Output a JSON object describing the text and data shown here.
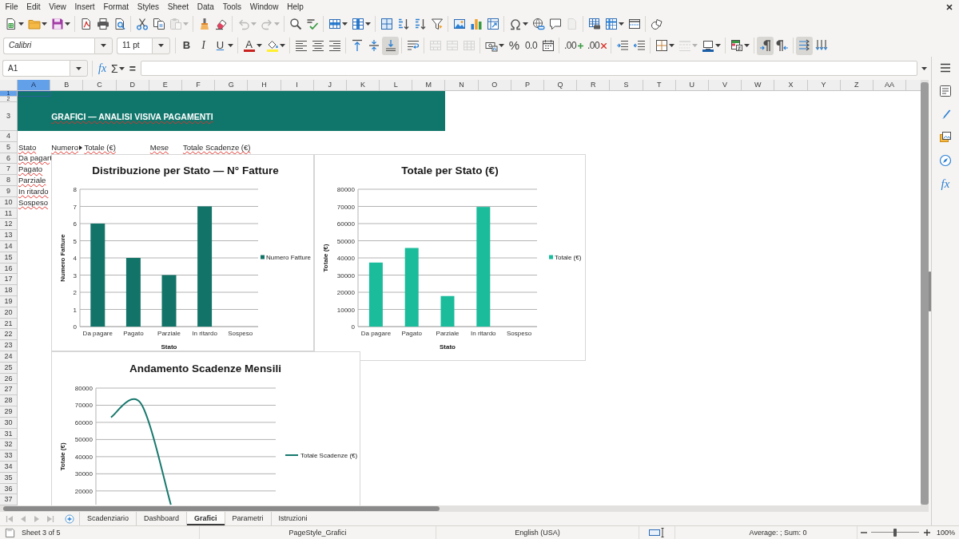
{
  "menu": [
    {
      "label": "File"
    },
    {
      "label": "Edit"
    },
    {
      "label": "View"
    },
    {
      "label": "Insert"
    },
    {
      "label": "Format"
    },
    {
      "label": "Styles"
    },
    {
      "label": "Sheet"
    },
    {
      "label": "Data"
    },
    {
      "label": "Tools"
    },
    {
      "label": "Window"
    },
    {
      "label": "Help"
    }
  ],
  "standard_toolbar": [
    [
      {
        "kind": "new",
        "dropdown": true,
        "disabled": false
      },
      {
        "kind": "open",
        "dropdown": true,
        "disabled": false
      },
      {
        "kind": "save",
        "dropdown": true,
        "disabled": false
      }
    ],
    [
      {
        "kind": "pdf",
        "disabled": false
      },
      {
        "kind": "print",
        "disabled": false
      },
      {
        "kind": "preview",
        "disabled": false
      }
    ],
    [
      {
        "kind": "cut",
        "disabled": false
      },
      {
        "kind": "copy",
        "disabled": false
      },
      {
        "kind": "paste",
        "dropdown": true,
        "disabled": true
      }
    ],
    [
      {
        "kind": "clone",
        "disabled": false
      },
      {
        "kind": "clear",
        "disabled": false
      }
    ],
    [
      {
        "kind": "undo",
        "dropdown": true,
        "disabled": true
      },
      {
        "kind": "redo",
        "dropdown": true,
        "disabled": true
      }
    ],
    [
      {
        "kind": "find",
        "disabled": false
      },
      {
        "kind": "spelling",
        "disabled": false
      }
    ],
    [
      {
        "kind": "row",
        "dropdown": true,
        "disabled": false
      },
      {
        "kind": "column",
        "dropdown": true,
        "disabled": false
      }
    ],
    [
      {
        "kind": "sort",
        "disabled": false
      },
      {
        "kind": "ascending",
        "disabled": false
      },
      {
        "kind": "descending",
        "disabled": false
      },
      {
        "kind": "filter",
        "disabled": false
      }
    ],
    [
      {
        "kind": "image",
        "disabled": false
      },
      {
        "kind": "chart",
        "disabled": false
      },
      {
        "kind": "pivot",
        "disabled": false
      }
    ],
    [
      {
        "kind": "special",
        "dropdown": true,
        "disabled": false
      },
      {
        "kind": "hyperlink",
        "disabled": false
      },
      {
        "kind": "comment",
        "disabled": false
      },
      {
        "kind": "header",
        "disabled": true
      }
    ],
    [
      {
        "kind": "printarea",
        "disabled": false
      },
      {
        "kind": "freeze",
        "dropdown": true,
        "disabled": false
      },
      {
        "kind": "split",
        "disabled": false
      }
    ],
    [
      {
        "kind": "draw",
        "disabled": false
      }
    ]
  ],
  "formatting_toolbar": {
    "font_name": "Calibri",
    "font_size": "11 pt",
    "groups": [
      [
        {
          "kind": "bold",
          "label": "B",
          "disabled": false,
          "pressed": false
        },
        {
          "kind": "italic",
          "label": "I",
          "disabled": false,
          "pressed": false
        },
        {
          "kind": "underline",
          "label": "U",
          "dropdown": true,
          "disabled": false,
          "pressed": false
        }
      ],
      [
        {
          "kind": "fontcolor",
          "label": "A",
          "color": "#c9211e",
          "dropdown": true,
          "disabled": false,
          "pressed": false
        },
        {
          "kind": "highlight",
          "color": "#ffef2e",
          "dropdown": true,
          "disabled": false,
          "pressed": false
        }
      ],
      [
        {
          "kind": "left",
          "disabled": false,
          "pressed": false
        },
        {
          "kind": "center",
          "disabled": false,
          "pressed": false
        },
        {
          "kind": "right",
          "disabled": false,
          "pressed": false
        }
      ],
      [
        {
          "kind": "top",
          "disabled": false,
          "pressed": false
        },
        {
          "kind": "middle",
          "disabled": false,
          "pressed": false
        },
        {
          "kind": "bottom",
          "disabled": false,
          "pressed": true
        }
      ],
      [
        {
          "kind": "wrap",
          "disabled": false,
          "pressed": false
        }
      ],
      [
        {
          "kind": "mergecenter",
          "disabled": true,
          "pressed": false
        },
        {
          "kind": "merge",
          "disabled": true,
          "pressed": false
        },
        {
          "kind": "unmerge",
          "disabled": true,
          "pressed": false
        }
      ],
      [
        {
          "kind": "currency",
          "dropdown": true,
          "disabled": false,
          "pressed": false
        },
        {
          "kind": "percent",
          "label": "%",
          "disabled": false,
          "pressed": false
        },
        {
          "kind": "number",
          "label": "0.0",
          "disabled": false,
          "pressed": false
        },
        {
          "kind": "date",
          "disabled": false,
          "pressed": false
        }
      ],
      [
        {
          "kind": "adddecimal",
          "label": ".00",
          "disabled": false,
          "pressed": false
        },
        {
          "kind": "deldecimal",
          "label": ".00",
          "disabled": false,
          "pressed": false
        }
      ],
      [
        {
          "kind": "indent",
          "disabled": false,
          "pressed": false
        },
        {
          "kind": "outdent",
          "disabled": false,
          "pressed": false
        }
      ],
      [
        {
          "kind": "borders",
          "dropdown": true,
          "disabled": false,
          "pressed": false
        },
        {
          "kind": "borderstyle",
          "dropdown": true,
          "disabled": true,
          "pressed": false
        },
        {
          "kind": "bordercolor",
          "color": "#1c5fa8",
          "dropdown": true,
          "disabled": false,
          "pressed": false
        }
      ],
      [
        {
          "kind": "conditional",
          "dropdown": true,
          "disabled": false,
          "pressed": false
        }
      ],
      [
        {
          "kind": "ltr",
          "disabled": false,
          "pressed": true
        },
        {
          "kind": "rtl",
          "disabled": false,
          "pressed": false
        }
      ],
      [
        {
          "kind": "textltr",
          "disabled": false,
          "pressed": true
        },
        {
          "kind": "vertical",
          "disabled": false,
          "pressed": false
        }
      ]
    ]
  },
  "formula_bar": {
    "cell": "A1",
    "buttons": [
      {
        "kind": "wizard",
        "label": "fx"
      },
      {
        "kind": "sum",
        "label": "Σ",
        "dropdown": true
      },
      {
        "kind": "formula",
        "label": "="
      }
    ]
  },
  "sidebar": [
    {
      "kind": "menu"
    },
    {
      "kind": "properties"
    },
    {
      "kind": "styles"
    },
    {
      "kind": "gallery"
    },
    {
      "kind": "navigator"
    },
    {
      "kind": "functions",
      "label": "fx"
    }
  ],
  "columns": [
    {
      "label": "A",
      "selected": true
    },
    {
      "label": "B",
      "selected": false
    },
    {
      "label": "C",
      "selected": false
    },
    {
      "label": "D",
      "selected": false
    },
    {
      "label": "E",
      "selected": false
    },
    {
      "label": "F",
      "selected": false
    },
    {
      "label": "G",
      "selected": false
    },
    {
      "label": "H",
      "selected": false
    },
    {
      "label": "I",
      "selected": false
    },
    {
      "label": "J",
      "selected": false
    },
    {
      "label": "K",
      "selected": false
    },
    {
      "label": "L",
      "selected": false
    },
    {
      "label": "M",
      "selected": false
    },
    {
      "label": "N",
      "selected": false
    },
    {
      "label": "O",
      "selected": false
    },
    {
      "label": "P",
      "selected": false
    },
    {
      "label": "Q",
      "selected": false
    },
    {
      "label": "R",
      "selected": false
    },
    {
      "label": "S",
      "selected": false
    },
    {
      "label": "T",
      "selected": false
    },
    {
      "label": "U",
      "selected": false
    },
    {
      "label": "V",
      "selected": false
    },
    {
      "label": "W",
      "selected": false
    },
    {
      "label": "X",
      "selected": false
    },
    {
      "label": "Y",
      "selected": false
    },
    {
      "label": "Z",
      "selected": false
    },
    {
      "label": "AA",
      "selected": false
    }
  ],
  "rows": [
    {
      "label": "1",
      "selected": true
    },
    {
      "label": "2",
      "selected": false
    },
    {
      "label": "3",
      "selected": false
    },
    {
      "label": "4",
      "selected": false
    },
    {
      "label": "5",
      "selected": false
    },
    {
      "label": "6",
      "selected": false
    },
    {
      "label": "7",
      "selected": false
    },
    {
      "label": "8",
      "selected": false
    },
    {
      "label": "9",
      "selected": false
    },
    {
      "label": "10",
      "selected": false
    },
    {
      "label": "11",
      "selected": false
    },
    {
      "label": "12",
      "selected": false
    },
    {
      "label": "13",
      "selected": false
    },
    {
      "label": "14",
      "selected": false
    },
    {
      "label": "15",
      "selected": false
    },
    {
      "label": "16",
      "selected": false
    },
    {
      "label": "17",
      "selected": false
    },
    {
      "label": "18",
      "selected": false
    },
    {
      "label": "19",
      "selected": false
    },
    {
      "label": "20",
      "selected": false
    },
    {
      "label": "21",
      "selected": false
    },
    {
      "label": "22",
      "selected": false
    },
    {
      "label": "23",
      "selected": false
    },
    {
      "label": "24",
      "selected": false
    },
    {
      "label": "25",
      "selected": false
    },
    {
      "label": "26",
      "selected": false
    },
    {
      "label": "27",
      "selected": false
    },
    {
      "label": "28",
      "selected": false
    },
    {
      "label": "29",
      "selected": false
    },
    {
      "label": "30",
      "selected": false
    },
    {
      "label": "31",
      "selected": false
    },
    {
      "label": "32",
      "selected": false
    },
    {
      "label": "33",
      "selected": false
    },
    {
      "label": "34",
      "selected": false
    },
    {
      "label": "35",
      "selected": false
    },
    {
      "label": "36",
      "selected": false
    },
    {
      "label": "37",
      "selected": false
    }
  ],
  "banner": {
    "title": "GRAFICI — ANALISI VISIVA PAGAMENTI"
  },
  "status_table": {
    "header": [
      {
        "text": "Stato",
        "truncated": false
      },
      {
        "text": "Numero",
        "truncated": true
      },
      {
        "text": "Totale (€)",
        "truncated": false
      }
    ],
    "rows": [
      {
        "text": "Da pagar",
        "truncated": true
      },
      {
        "text": "Pagato",
        "truncated": false
      },
      {
        "text": "Parziale",
        "truncated": false
      },
      {
        "text": "In ritardo",
        "truncated": false
      },
      {
        "text": "Sospeso",
        "truncated": false
      }
    ]
  },
  "monthly_table": {
    "header": [
      {
        "text": "Mese"
      },
      {
        "text": "Totale Scadenze (€)"
      }
    ]
  },
  "charts": [
    {
      "chart_data": {
        "type": "bar",
        "title": "Distribuzione per Stato — N° Fatture",
        "xlabel": "Stato",
        "ylabel": "Numero Fatture",
        "categories": [
          "Da pagare",
          "Pagato",
          "Parziale",
          "In ritardo",
          "Sospeso"
        ],
        "series": [
          {
            "name": "Numero Fatture",
            "color": "#127468",
            "values": [
              6,
              4,
              3,
              7,
              0
            ]
          }
        ],
        "ylim": [
          0,
          8
        ],
        "yticks": [
          0,
          1,
          2,
          3,
          4,
          5,
          6,
          7,
          8
        ],
        "grid": true
      }
    },
    {
      "chart_data": {
        "type": "bar",
        "title": "Totale per Stato (€)",
        "xlabel": "Stato",
        "ylabel": "Totale (€)",
        "categories": [
          "Da pagare",
          "Pagato",
          "Parziale",
          "In ritardo",
          "Sospeso"
        ],
        "series": [
          {
            "name": "Totale (€)",
            "color": "#1abc9c",
            "values": [
              37300,
              45800,
              17800,
              69700,
              0
            ]
          }
        ],
        "ylim": [
          0,
          80000
        ],
        "yticks": [
          0,
          10000,
          20000,
          30000,
          40000,
          50000,
          60000,
          70000,
          80000
        ],
        "grid": true
      }
    },
    {
      "chart_data": {
        "type": "line",
        "title": "Andamento Scadenze Mensili",
        "ylabel": "Totale (€)",
        "categories": [
          null,
          null,
          null,
          null,
          null,
          null
        ],
        "series": [
          {
            "name": "Totale Scadenze (€)",
            "color": "#17786d",
            "values": [
              63000,
              71000,
              12000,
              null,
              null,
              null
            ]
          }
        ],
        "ylim": [
          12000,
          80000
        ],
        "yticks": [
          20000,
          30000,
          40000,
          50000,
          60000,
          70000,
          80000
        ],
        "grid": true
      }
    }
  ],
  "sheet_navigation": [
    {
      "kind": "first",
      "disabled": true
    },
    {
      "kind": "previous",
      "disabled": true
    },
    {
      "kind": "next",
      "disabled": true
    },
    {
      "kind": "last",
      "disabled": true
    }
  ],
  "sheet_tabs": [
    {
      "label": "Scadenziario",
      "selected": false
    },
    {
      "label": "Dashboard",
      "selected": false
    },
    {
      "label": "Grafici",
      "selected": true
    },
    {
      "label": "Parametri",
      "selected": false
    },
    {
      "label": "Istruzioni",
      "selected": false
    }
  ],
  "status_bar": {
    "sheet": "Sheet 3 of 5",
    "page_style": "PageStyle_Grafici",
    "language": "English (USA)",
    "summary": "Average: ; Sum: 0",
    "zoom": {
      "level": 0.5,
      "reading": "100%"
    }
  }
}
